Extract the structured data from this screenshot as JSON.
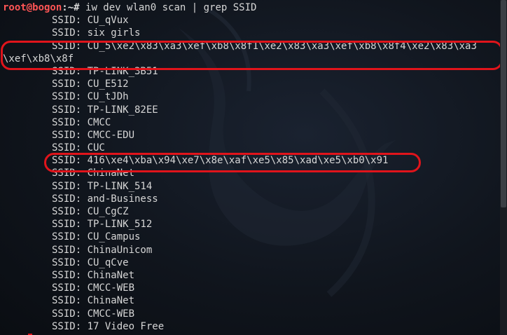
{
  "terminal": {
    "prompt_user": "root@bogon",
    "prompt_sep": ":~# ",
    "command": "iw dev wlan0 scan | grep SSID",
    "prefix": "SSID: ",
    "ssids": [
      "CU_qVux",
      "six girls",
      "CU_5\\xe2\\x83\\xa3\\xef\\xb8\\x8f1\\xe2\\x83\\xa3\\xef\\xb8\\x8f4\\xe2\\x83\\xa3",
      "TP-LINK_3B51",
      "CU_E512",
      "CU_tJDh",
      "TP-LINK_82EE",
      "CMCC",
      "CMCC-EDU",
      "CUC",
      "416\\xe4\\xba\\x94\\xe7\\x8e\\xaf\\xe5\\x85\\xad\\xe5\\xb0\\x91",
      "ChinaNet",
      "TP-LINK_514",
      "and-Business",
      "CU_CgCZ",
      "TP-LINK_512",
      "CU_Campus",
      "ChinaUnicom",
      "CU_qCve",
      "ChinaNet",
      "CMCC-WEB",
      "ChinaNet",
      "CMCC-WEB",
      "17 Video Free"
    ],
    "wrap_continuation": "\\xef\\xb8\\x8f"
  },
  "colors": {
    "background": "#0d1117",
    "prompt_user": "#ff5555",
    "text": "#d6d6d6",
    "highlight": "#e0141b"
  }
}
